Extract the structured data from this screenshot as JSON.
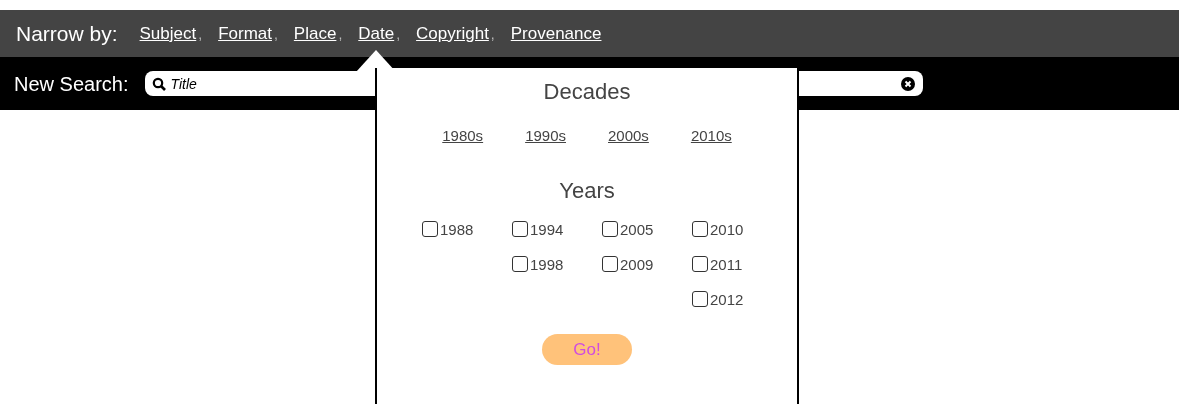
{
  "narrow_by": {
    "label": "Narrow by:",
    "facets": [
      {
        "label": "Subject",
        "separator": ",",
        "selected": false
      },
      {
        "label": "Format",
        "separator": ",",
        "selected": false
      },
      {
        "label": "Place",
        "separator": ",",
        "selected": false
      },
      {
        "label": "Date",
        "separator": ",",
        "selected": true
      },
      {
        "label": "Copyright",
        "separator": ",",
        "selected": false
      },
      {
        "label": "Provenance",
        "selected": false
      }
    ]
  },
  "new_search": {
    "label": "New Search:",
    "placeholder": "Title"
  },
  "date_popup": {
    "decades_title": "Decades",
    "decades": [
      "1980s",
      "1990s",
      "2000s",
      "2010s"
    ],
    "years_title": "Years",
    "year_columns": [
      [
        {
          "label": "1988",
          "checked": false
        }
      ],
      [
        {
          "label": "1994",
          "checked": false
        },
        {
          "label": "1998",
          "checked": false
        }
      ],
      [
        {
          "label": "2005",
          "checked": false
        },
        {
          "label": "2009",
          "checked": false
        }
      ],
      [
        {
          "label": "2010",
          "checked": false
        },
        {
          "label": "2011",
          "checked": false
        },
        {
          "label": "2012",
          "checked": false
        }
      ]
    ],
    "go_button": "Go!"
  }
}
